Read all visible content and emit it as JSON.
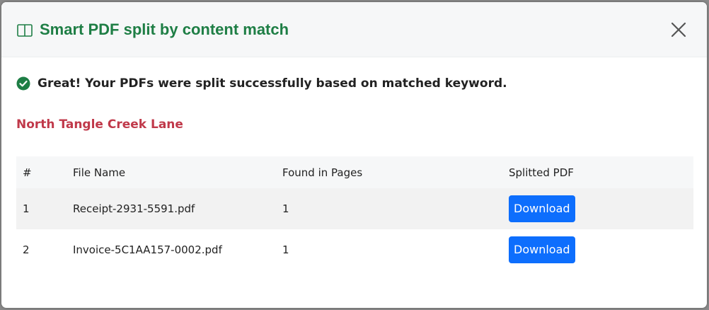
{
  "modal": {
    "title": "Smart PDF split by content match",
    "success_message": "Great! Your PDFs were split successfully based on matched keyword.",
    "keyword": "North Tangle Creek Lane",
    "colors": {
      "title": "#1e7e45",
      "keyword": "#c0394a",
      "success_icon": "#1e7e45",
      "button": "#0d6efd"
    }
  },
  "table": {
    "headers": [
      "#",
      "File Name",
      "Found in Pages",
      "Splitted PDF"
    ],
    "rows": [
      {
        "num": "1",
        "file": "Receipt-2931-5591.pdf",
        "pages": "1",
        "action": "Download"
      },
      {
        "num": "2",
        "file": "Invoice-5C1AA157-0002.pdf",
        "pages": "1",
        "action": "Download"
      }
    ]
  }
}
